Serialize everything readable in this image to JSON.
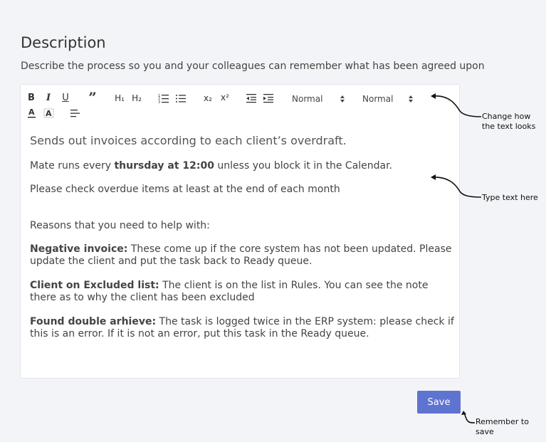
{
  "header": {
    "title": "Description",
    "subtitle": "Describe the process so you and your colleagues can remember what has been agreed upon"
  },
  "toolbar": {
    "bold": "B",
    "italic": "I",
    "underline": "U",
    "quote": "”",
    "h1": "H₁",
    "h2": "H₂",
    "subscript": "x₂",
    "superscript": "x²",
    "font_size_value": "Normal",
    "heading_value": "Normal"
  },
  "content": {
    "heading": "Sends out invoices according to each client’s overdraft.",
    "line1_pre": "Mate runs every ",
    "line1_bold": "thursday at 12:00",
    "line1_post": "  unless you block it in the Calendar.",
    "line2": "Please check overdue items at least at the end of each month",
    "reasons": "Reasons that you need to help with:",
    "items": [
      {
        "label": "Negative invoice:",
        "text": " These come up if the core system has not been updated. Please update the client and put the task back to Ready queue."
      },
      {
        "label": "Client on Excluded list:",
        "text": " The client is on the list in Rules. You can see the note there as to why the client has been excluded"
      },
      {
        "label": "Found double arhieve:",
        "text": " The task is logged twice in the ERP system: please check if this is an error. If it is not an error, put this task in the Ready queue."
      }
    ]
  },
  "annotations": {
    "toolbar_note_line1": "Change how",
    "toolbar_note_line2": "the text looks",
    "content_note": "Type text here",
    "save_note": "Remember to save"
  },
  "actions": {
    "save_label": "Save"
  },
  "colors": {
    "accent": "#5f73d0",
    "background": "#f3f4f7"
  }
}
